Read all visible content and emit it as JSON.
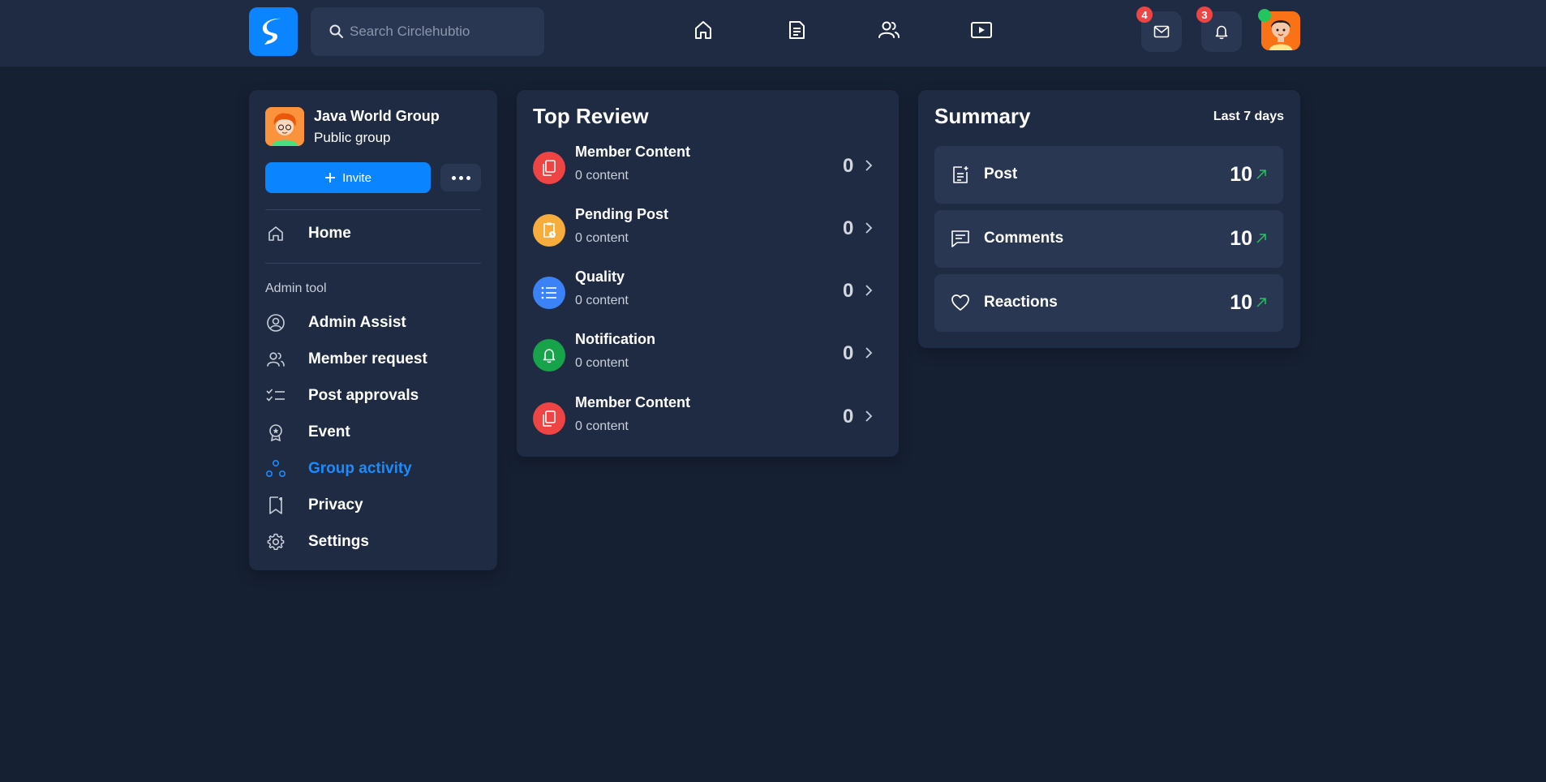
{
  "search": {
    "placeholder": "Search Circlehubtio"
  },
  "header": {
    "messages_count": "4",
    "notifications_count": "3"
  },
  "group": {
    "name": "Java World Group",
    "type": "Public group",
    "invite_label": "Invite"
  },
  "sidebar": {
    "home_label": "Home",
    "admin_section_label": "Admin tool",
    "items": [
      {
        "label": "Admin Assist",
        "icon": "user-circle-icon"
      },
      {
        "label": "Member request",
        "icon": "users-icon"
      },
      {
        "label": "Post approvals",
        "icon": "checklist-icon"
      },
      {
        "label": "Event",
        "icon": "award-icon"
      },
      {
        "label": "Group activity",
        "icon": "activity-icon",
        "active": true
      },
      {
        "label": "Privacy",
        "icon": "bookmark-icon"
      },
      {
        "label": "Settings",
        "icon": "gear-icon"
      }
    ]
  },
  "top_review": {
    "title": "Top Review",
    "items": [
      {
        "title": "Member Content",
        "subtitle": "0 content",
        "count": "0",
        "color": "#ef4444"
      },
      {
        "title": "Pending Post",
        "subtitle": "0 content",
        "count": "0",
        "color": "#f6ad3b"
      },
      {
        "title": "Quality",
        "subtitle": "0 content",
        "count": "0",
        "color": "#3b82f6"
      },
      {
        "title": "Notification",
        "subtitle": "0 content",
        "count": "0",
        "color": "#16a34a"
      },
      {
        "title": "Member Content",
        "subtitle": "0 content",
        "count": "0",
        "color": "#ef4444"
      }
    ]
  },
  "summary": {
    "title": "Summary",
    "range": "Last 7 days",
    "items": [
      {
        "label": "Post",
        "value": "10",
        "icon": "post-icon"
      },
      {
        "label": "Comments",
        "value": "10",
        "icon": "comment-icon"
      },
      {
        "label": "Reactions",
        "value": "10",
        "icon": "heart-icon"
      }
    ]
  },
  "colors": {
    "background": "#162033",
    "card": "#1f2b42",
    "accent": "#0a84ff",
    "badge": "#ef4444",
    "trend": "#22c55e"
  }
}
